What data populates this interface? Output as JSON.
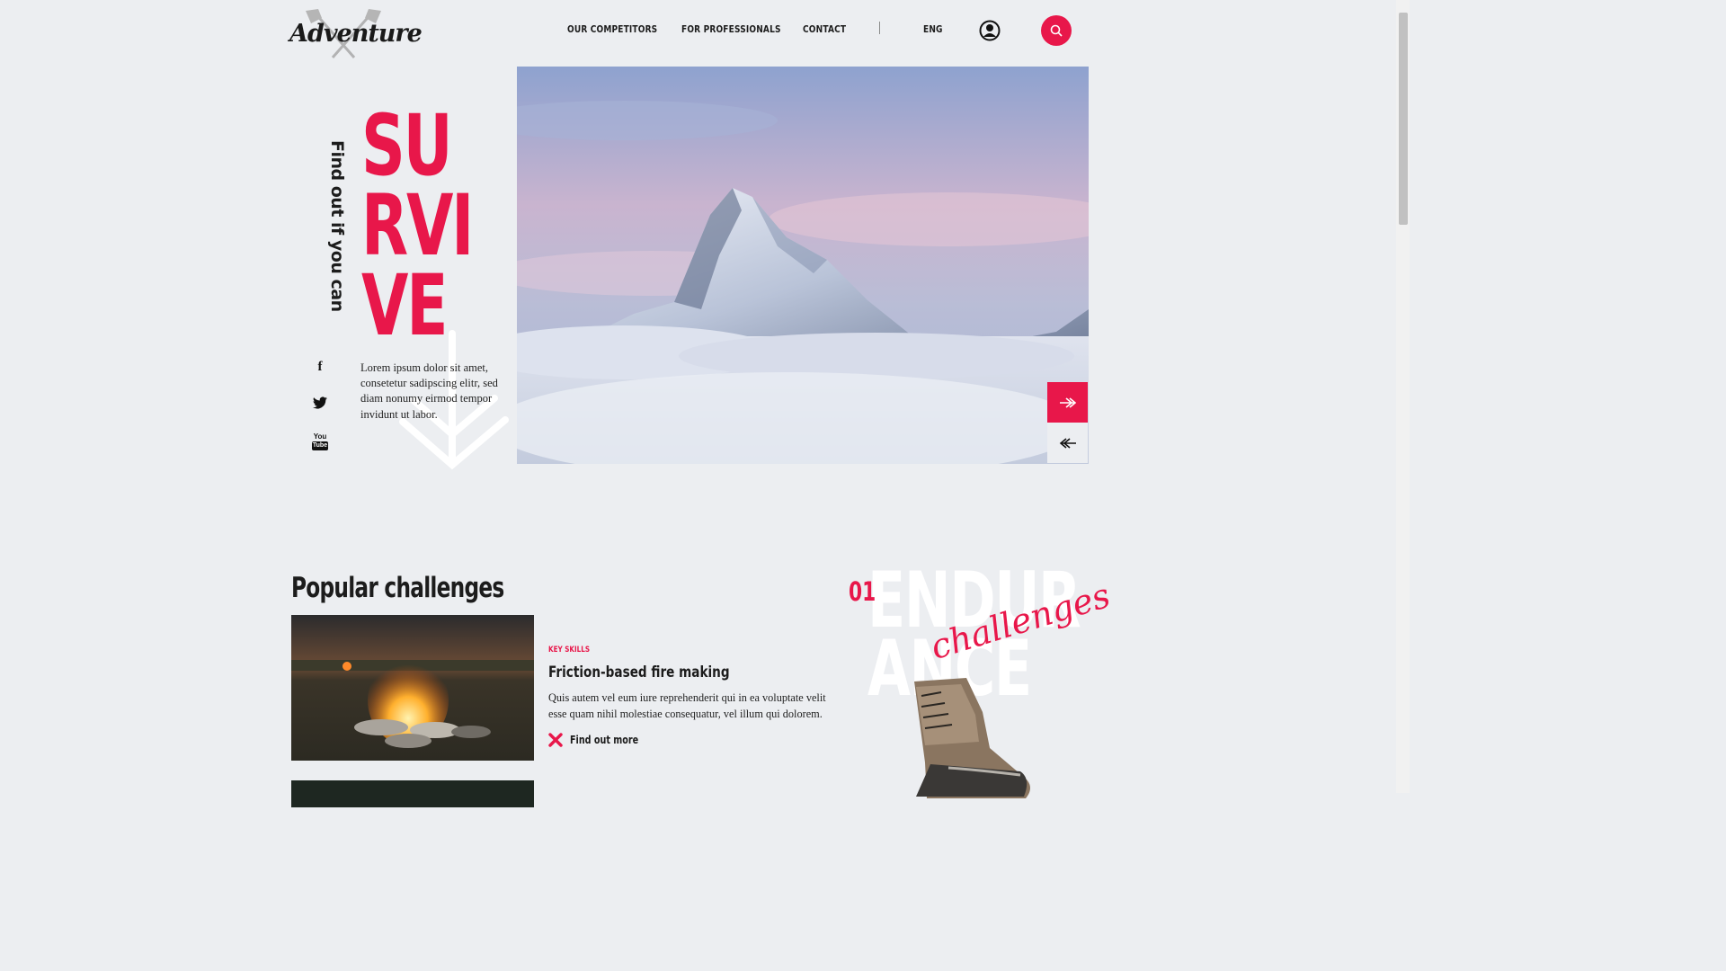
{
  "brand": {
    "logo_text": "Adventure"
  },
  "nav": {
    "items": [
      "OUR COMPETITORS",
      "FOR PROFESSIONALS",
      "CONTACT"
    ],
    "language": "ENG"
  },
  "hero": {
    "tagline": "Find out if you can",
    "headline_lines": [
      "SU",
      "RVI",
      "VE"
    ],
    "description": "Lorem ipsum dolor sit amet, consetetur sadipscing elitr, sed diam nonumy eirmod tempor invidunt ut labor."
  },
  "social": [
    "facebook-icon",
    "twitter-icon",
    "youtube-icon"
  ],
  "social_labels": {
    "youtube_top": "You",
    "youtube_bottom": "Tube",
    "facebook": "f"
  },
  "challenges": {
    "section_title": "Popular challenges",
    "card": {
      "category": "KEY SKILLS",
      "title": "Friction-based fire making",
      "description": "Quis autem vel eum iure reprehenderit qui in ea voluptate velit esse quam nihil molestiae consequatur, vel illum qui dolorem.",
      "link": "Find out more"
    },
    "feature": {
      "number": "01",
      "word_lines": [
        "ENDUR",
        "ANCE"
      ],
      "script": "challenges"
    }
  },
  "colors": {
    "accent": "#e8174a",
    "background": "#eceef1"
  }
}
